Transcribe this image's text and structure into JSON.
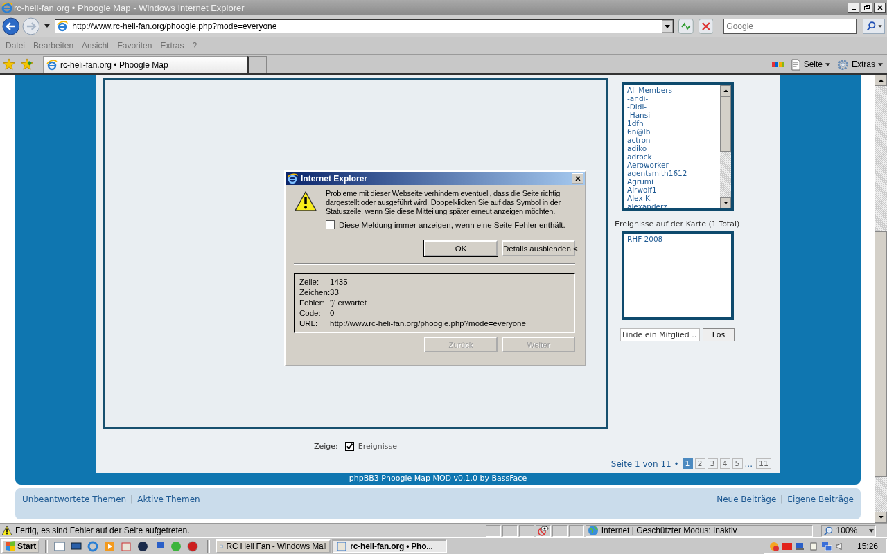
{
  "window": {
    "title": "rc-heli-fan.org • Phoogle Map - Windows Internet Explorer"
  },
  "address_bar": {
    "url": "http://www.rc-heli-fan.org/phoogle.php?mode=everyone"
  },
  "search": {
    "placeholder": "Google"
  },
  "menu": [
    "Datei",
    "Bearbeiten",
    "Ansicht",
    "Favoriten",
    "Extras",
    "?"
  ],
  "tabs": [
    {
      "label": "rc-heli-fan.org • Phoogle Map",
      "selected": true
    }
  ],
  "command_bar": [
    "Seite",
    "Extras"
  ],
  "page": {
    "members": [
      "All Members",
      "-andi-",
      "-Didi-",
      "-Hansi-",
      "1dfh",
      "6n@lb",
      "actron",
      "adiko",
      "adrock",
      "Aeroworker",
      "agentsmith1612",
      "Agrumi",
      "Airwolf1",
      "Alex K.",
      "alexanderz"
    ],
    "events": {
      "label": "Ereignisse auf der Karte (1 Total)",
      "items": [
        "RHF 2008"
      ]
    },
    "find": {
      "value": "Finde ein Mitglied ..",
      "button": "Los"
    },
    "show": {
      "label": "Zeige:",
      "option": "Ereignisse",
      "checked": true
    },
    "pagination": {
      "label": "Seite 1 von 11 •",
      "pages": [
        {
          "label": "1",
          "selected": true
        },
        {
          "label": "2",
          "selected": false
        },
        {
          "label": "3",
          "selected": false
        },
        {
          "label": "4",
          "selected": false
        },
        {
          "label": "5",
          "selected": false
        }
      ],
      "ellipsis": "...",
      "last": {
        "label": "11",
        "selected": false
      }
    },
    "credit": "phpBB3 Phoogle Map MOD v0.1.0 by BassFace",
    "nav_separator": "|",
    "nav_left": [
      "Unbeantwortete Themen",
      "Aktive Themen"
    ],
    "nav_right": [
      "Neue Beiträge",
      "Eigene Beiträge"
    ]
  },
  "dialog": {
    "title": "Internet Explorer",
    "message": "Probleme mit dieser Webseite verhindern eventuell, dass die Seite richtig dargestellt oder ausgeführt wird. Doppelklicken Sie auf das Symbol in der Statuszeile, wenn Sie diese Mitteilung später erneut anzeigen möchten.",
    "checkbox": {
      "label": "Diese Meldung immer anzeigen, wenn eine Seite Fehler enthält.",
      "checked": false
    },
    "buttons": [
      {
        "label": "OK",
        "default": true
      },
      {
        "label": "Details ausblenden <",
        "default": false
      }
    ],
    "details": [
      {
        "label": "Zeile:",
        "value": "1435"
      },
      {
        "label": "Zeichen:",
        "value": "33"
      },
      {
        "label": "Fehler:",
        "value": "')' erwartet"
      },
      {
        "label": "Code:",
        "value": "0"
      },
      {
        "label": "URL:",
        "value": "http://www.rc-heli-fan.org/phoogle.php?mode=everyone"
      }
    ],
    "nav_buttons": [
      {
        "label": "Zurück",
        "disabled": true
      },
      {
        "label": "Weiter",
        "disabled": true
      }
    ]
  },
  "status_bar": {
    "message": "Fertig, es sind Fehler auf der Seite aufgetreten.",
    "zone": "Internet | Geschützter Modus: Inaktiv",
    "zoom": "100%"
  },
  "taskbar": {
    "start": "Start",
    "tasks": [
      {
        "label": "RC Heli Fan - Windows Mail",
        "selected": false
      },
      {
        "label": "rc-heli-fan.org • Pho...",
        "selected": true
      }
    ],
    "clock": "15:26"
  }
}
